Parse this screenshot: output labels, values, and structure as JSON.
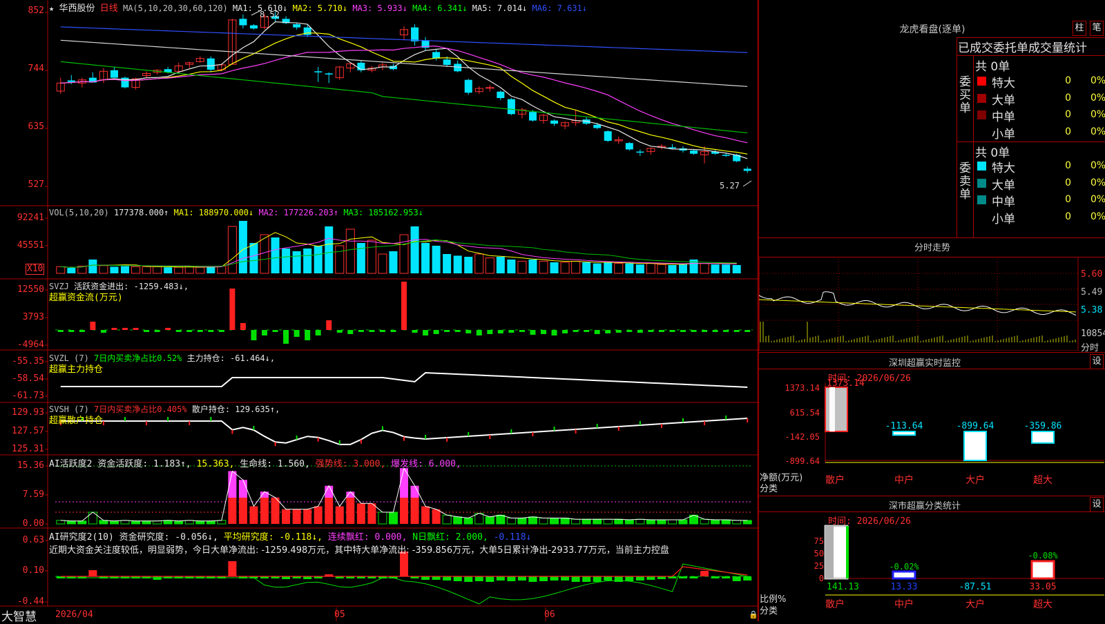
{
  "app": {
    "brand": "大智慧"
  },
  "kline": {
    "star": "★",
    "stock_name": "华西股份",
    "period": "日线",
    "ma_label": "MA(5,10,20,30,60,120)",
    "ma1": "MA1: 5.610↓",
    "ma2": "MA2: 5.710↓",
    "ma3": "MA3: 5.933↓",
    "ma4": "MA4: 6.341↓",
    "ma5": "MA5: 7.014↓",
    "ma6": "MA6: 7.631↓",
    "high_marker": "8.52",
    "low_marker": "5.27",
    "y_ticks": [
      "852",
      "744",
      "635",
      "527"
    ]
  },
  "vol": {
    "label": "VOL(5,10,20)",
    "value": "177378.000↑",
    "ma1": "MA1: 188970.000↓",
    "ma2": "MA2: 177226.203↑",
    "ma3": "MA3: 185162.953↓",
    "y_ticks": [
      "92241",
      "45551"
    ],
    "unit": "X10"
  },
  "svzj": {
    "label": "SVZJ",
    "line": "活跃资金进出: -1259.483↓,",
    "name": "超赢资金流(万元)",
    "y_ticks": [
      "12550",
      "3793",
      "-4964"
    ]
  },
  "svzl": {
    "label": "SVZL (7)",
    "ratio": "7日内买卖净占比0.52%",
    "pos": "主力持仓: -61.464↓,",
    "name": "超赢主力持仓",
    "y_ticks": [
      "-55.35",
      "-58.54",
      "-61.73"
    ]
  },
  "svsh": {
    "label": "SVSH (7)",
    "ratio": "7日内买卖净占比0.405%",
    "pos": "散户持仓: 129.635↑,",
    "name": "超赢散户持仓",
    "y_ticks": [
      "129.93",
      "127.57",
      "125.31"
    ]
  },
  "ai1": {
    "label": "AI活跃度2",
    "a": "资金活跃度: 1.183↑,",
    "b": "15.363,",
    "c": "生命线: 1.560,",
    "d": "强势线: 3.000,",
    "e": "爆发线: 6.000,",
    "y_ticks": [
      "15.36",
      "7.59",
      "0.00"
    ]
  },
  "ai2": {
    "label": "AI研究度2(10)",
    "a": "资金研究度: -0.056↓,",
    "b": "平均研究度: -0.118↓,",
    "c": "连续飘红: 0.000,",
    "d": "N日飘红: 2.000,",
    "e": "-0.118↓",
    "desc": "近期大资金关注度较低，明显弱势，今日大单净流出: -1259.498万元，其中特大单净流出: -359.856万元，大单5日累计净出-2933.77万元，当前主力控盘",
    "y_ticks": [
      "0.63",
      "0.10",
      "-0.44"
    ]
  },
  "date_axis": [
    "2026/04",
    "05",
    "06"
  ],
  "lhb": {
    "title": "龙虎看盘(逐单)",
    "btn1": "柱",
    "btn2": "笔",
    "sub": "已成交委托单成交量统计",
    "buy_label": "委买单",
    "sell_label": "委卖单",
    "total": "共 0单",
    "rows": [
      {
        "name": "特大",
        "count": "0",
        "pct": "0%"
      },
      {
        "name": "大单",
        "count": "0",
        "pct": "0%"
      },
      {
        "name": "中单",
        "count": "0",
        "pct": "0%"
      },
      {
        "name": "小单",
        "count": "0",
        "pct": "0%"
      }
    ],
    "buy_colors": [
      "#ff0000",
      "#a00000",
      "#800000",
      ""
    ],
    "sell_colors": [
      "#00e5ff",
      "#008a8a",
      "#008a8a",
      ""
    ]
  },
  "fenshi": {
    "title": "分时走势",
    "y_ticks": [
      "5.60",
      "5.49",
      "5.38"
    ],
    "vol_tick": "10854",
    "xlabel": "分时"
  },
  "sz_monitor": {
    "title": "深圳超赢实时监控",
    "set": "设",
    "time_label": "时间: 2026/06/26",
    "y_ticks": [
      "1373.14",
      "615.54",
      "-142.05",
      "-899.64"
    ],
    "ylabel1": "净额(万元)",
    "ylabel2": "分类",
    "categories": [
      "散户",
      "中户",
      "大户",
      "超大"
    ],
    "values": [
      "1373.14",
      "-113.64",
      "-899.64",
      "-359.86"
    ]
  },
  "sz_class": {
    "title": "深市超赢分类统计",
    "set": "设",
    "time_label": "时间: 2026/06/26",
    "y_ticks": [
      "75",
      "50",
      "25",
      "0"
    ],
    "ylabel1": "比例%",
    "ylabel2": "分类",
    "categories": [
      "散户",
      "中户",
      "大户",
      "超大"
    ],
    "top_labels": [
      "",
      "-0.02%",
      "",
      "-0.08%"
    ],
    "bottom_values": [
      "141.13",
      "13.33",
      "-87.51",
      "33.05"
    ]
  },
  "chart_data": [
    {
      "type": "candlestick",
      "title": "华西股份 日线",
      "ylim": [
        5.27,
        8.52
      ],
      "ohlc": [
        [
          7.05,
          7.3,
          7.0,
          7.2
        ],
        [
          7.25,
          7.35,
          7.18,
          7.22
        ],
        [
          7.2,
          7.3,
          7.12,
          7.26
        ],
        [
          7.3,
          7.4,
          7.25,
          7.21
        ],
        [
          7.26,
          7.48,
          7.2,
          7.42
        ],
        [
          7.44,
          7.5,
          7.34,
          7.3
        ],
        [
          7.3,
          7.32,
          7.1,
          7.12
        ],
        [
          7.12,
          7.3,
          7.08,
          7.28
        ],
        [
          7.34,
          7.42,
          7.3,
          7.38
        ],
        [
          7.4,
          7.46,
          7.36,
          7.44
        ],
        [
          7.46,
          7.5,
          7.38,
          7.4
        ],
        [
          7.42,
          7.58,
          7.4,
          7.52
        ],
        [
          7.55,
          7.6,
          7.48,
          7.58
        ],
        [
          7.6,
          7.7,
          7.58,
          7.66
        ],
        [
          7.66,
          7.7,
          7.4,
          7.45
        ],
        [
          7.45,
          7.56,
          7.42,
          7.54
        ],
        [
          7.55,
          8.4,
          7.55,
          8.38
        ],
        [
          8.4,
          8.48,
          8.22,
          8.28
        ],
        [
          8.28,
          8.3,
          8.2,
          8.22
        ],
        [
          8.24,
          8.5,
          8.2,
          8.44
        ],
        [
          8.45,
          8.52,
          8.35,
          8.4
        ],
        [
          8.4,
          8.45,
          8.3,
          8.32
        ],
        [
          8.3,
          8.32,
          8.2,
          8.24
        ],
        [
          8.24,
          8.3,
          8.06,
          8.1
        ],
        [
          7.42,
          7.5,
          7.22,
          7.4
        ],
        [
          7.38,
          7.4,
          7.2,
          7.36
        ],
        [
          7.3,
          7.52,
          7.26,
          7.5
        ],
        [
          7.48,
          7.58,
          7.4,
          7.56
        ],
        [
          7.58,
          7.62,
          7.4,
          7.44
        ],
        [
          7.44,
          7.52,
          7.4,
          7.48
        ],
        [
          7.5,
          7.58,
          7.44,
          7.54
        ],
        [
          7.52,
          7.56,
          7.44,
          7.46
        ],
        [
          8.1,
          8.26,
          8.0,
          8.2
        ],
        [
          8.24,
          8.3,
          7.9,
          7.98
        ],
        [
          8.0,
          8.06,
          7.8,
          7.86
        ],
        [
          7.78,
          7.84,
          7.62,
          7.66
        ],
        [
          7.64,
          7.7,
          7.5,
          7.54
        ],
        [
          7.56,
          7.62,
          7.4,
          7.42
        ],
        [
          7.26,
          7.28,
          6.98,
          7.02
        ],
        [
          7.04,
          7.14,
          7.0,
          7.1
        ],
        [
          7.1,
          7.16,
          7.04,
          7.12
        ],
        [
          7.04,
          7.06,
          6.88,
          6.92
        ],
        [
          6.9,
          6.92,
          6.6,
          6.62
        ],
        [
          6.62,
          6.74,
          6.54,
          6.7
        ],
        [
          6.66,
          6.7,
          6.48,
          6.5
        ],
        [
          6.5,
          6.62,
          6.44,
          6.6
        ],
        [
          6.5,
          6.52,
          6.4,
          6.44
        ],
        [
          6.4,
          6.48,
          6.34,
          6.46
        ],
        [
          6.46,
          6.7,
          6.4,
          6.5
        ],
        [
          6.52,
          6.56,
          6.42,
          6.44
        ],
        [
          6.42,
          6.46,
          6.34,
          6.36
        ],
        [
          6.3,
          6.32,
          6.1,
          6.12
        ],
        [
          6.12,
          6.2,
          6.06,
          6.14
        ],
        [
          6.08,
          6.1,
          5.94,
          5.96
        ],
        [
          5.92,
          5.96,
          5.84,
          5.9
        ],
        [
          5.92,
          6.0,
          5.86,
          5.98
        ],
        [
          6.0,
          6.06,
          5.96,
          6.02
        ],
        [
          6.0,
          6.06,
          5.96,
          5.98
        ],
        [
          5.98,
          6.02,
          5.9,
          5.94
        ],
        [
          5.94,
          5.96,
          5.86,
          5.88
        ],
        [
          5.86,
          6.02,
          5.7,
          5.92
        ],
        [
          5.92,
          5.96,
          5.86,
          5.88
        ],
        [
          5.86,
          5.9,
          5.82,
          5.84
        ],
        [
          5.86,
          5.88,
          5.72,
          5.74
        ],
        [
          5.6,
          5.64,
          5.52,
          5.56
        ]
      ]
    }
  ]
}
